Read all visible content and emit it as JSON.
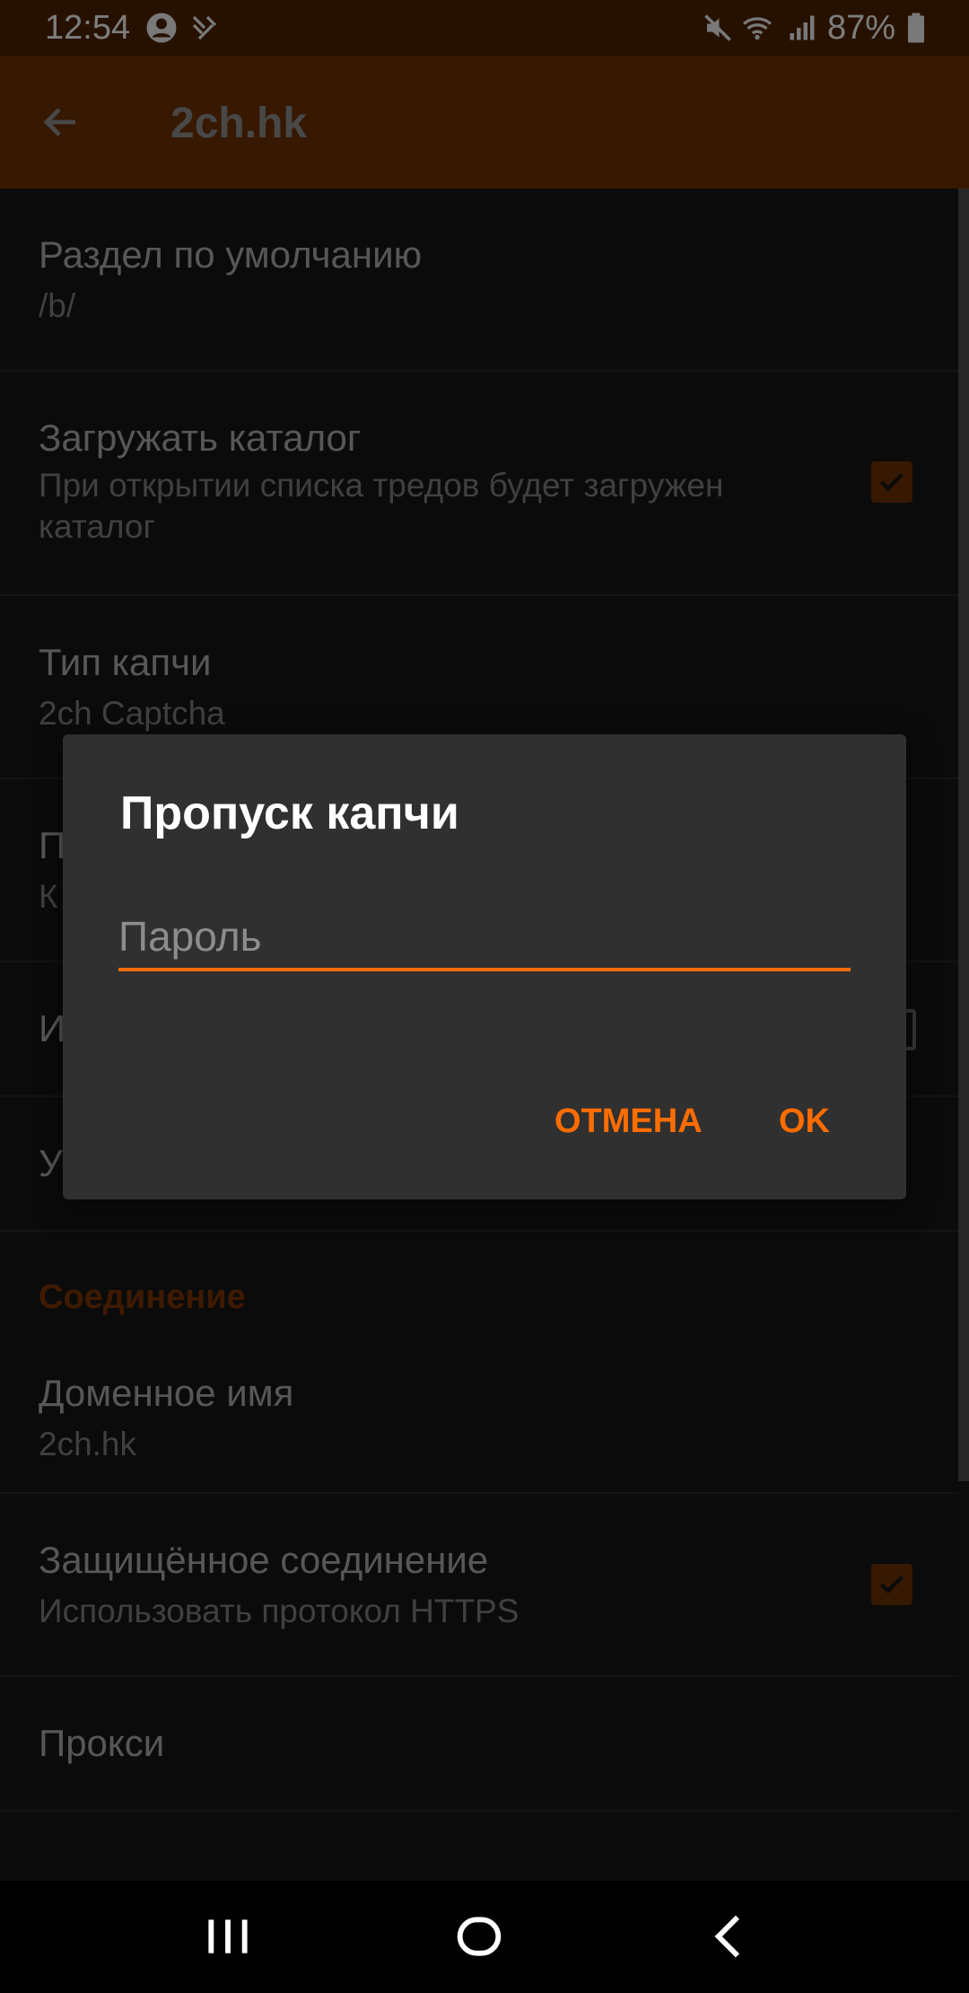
{
  "status_bar": {
    "time": "12:54",
    "battery": "87%",
    "icons": [
      "account-icon",
      "hands-icon",
      "mute-icon",
      "wifi-icon",
      "signal-icon",
      "battery-icon"
    ]
  },
  "app_bar": {
    "title": "2ch.hk",
    "back_icon": "arrow-left-icon"
  },
  "settings": {
    "default_board": {
      "title": "Раздел по умолчанию",
      "value": "/b/"
    },
    "load_catalog": {
      "title": "Загружать каталог",
      "summary": "При открытии списка тредов будет загружен каталог",
      "checked": true
    },
    "captcha_type": {
      "title": "Тип капчи",
      "value": "2ch Captcha"
    },
    "row4": {
      "title": "П",
      "value": "К"
    },
    "row5": {
      "title": "И",
      "checked": false
    },
    "row6": {
      "title": "У"
    },
    "connection_category": "Соединение",
    "domain": {
      "title": "Доменное имя",
      "value": "2ch.hk"
    },
    "https": {
      "title": "Защищённое соединение",
      "summary": "Использовать протокол HTTPS",
      "checked": true
    },
    "proxy": {
      "title": "Прокси"
    }
  },
  "dialog": {
    "title": "Пропуск капчи",
    "password_placeholder": "Пароль",
    "password_value": "",
    "cancel_label": "ОТМЕНА",
    "ok_label": "OK"
  },
  "nav_bar": {
    "icons": [
      "recents-icon",
      "home-icon",
      "back-icon"
    ]
  },
  "colors": {
    "status_bar": "#4a2100",
    "app_bar": "#6a2e00",
    "accent": "#ff6d00",
    "dialog_bg": "#303030"
  }
}
